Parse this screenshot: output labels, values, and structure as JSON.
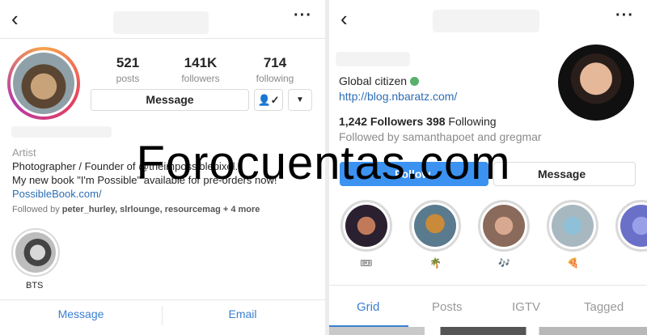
{
  "left": {
    "stats": [
      {
        "number": "521",
        "label": "posts"
      },
      {
        "number": "141K",
        "label": "followers"
      },
      {
        "number": "714",
        "label": "following"
      }
    ],
    "message_button": "Message",
    "bio": {
      "category": "Artist",
      "line1": "Photographer / Founder of @theimpossiblepixel.",
      "line2": "My new book \"I'm Possible\" available for pre-orders now!",
      "link": "PossibleBook.com/",
      "followed_by_prefix": "Followed by ",
      "followed_by_names": "peter_hurley, slrlounge, resourcemag",
      "followed_by_more": " + 4 more"
    },
    "highlight": {
      "label": "BTS"
    },
    "bottom_actions": [
      "Message",
      "Email"
    ]
  },
  "right": {
    "bio": {
      "line1": "Global citizen",
      "link": "http://blog.nbaratz.com/",
      "followers_count": "1,242",
      "followers_label": " Followers ",
      "following_count": "398",
      "following_label": " Following",
      "followed_by": "Followed by samanthapoet and gregmar"
    },
    "follow_button": "Follow",
    "message_button": "Message",
    "highlights": [
      {
        "emoji": "🎟"
      },
      {
        "emoji": "🌴"
      },
      {
        "emoji": "🎶"
      },
      {
        "emoji": "🍕"
      },
      {
        "emoji": ""
      }
    ],
    "tabs": [
      "Grid",
      "Posts",
      "IGTV",
      "Tagged"
    ],
    "active_tab": "Grid"
  },
  "watermark": "Forocuentas.com",
  "colors": {
    "accent": "#3b92f0",
    "link": "#2c6db5",
    "verified": "#58b06a"
  }
}
